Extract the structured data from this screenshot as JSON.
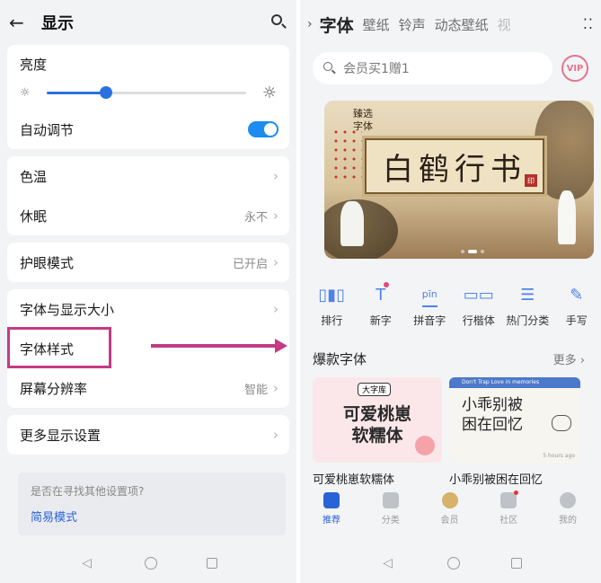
{
  "left": {
    "header": {
      "back_icon": "arrow-left-icon",
      "title": "显示",
      "search_icon": "search-icon"
    },
    "brightness": {
      "label": "亮度",
      "level": 0.3
    },
    "auto_adjust": {
      "label": "自动调节",
      "enabled": true
    },
    "rows_group2": [
      {
        "label": "色温",
        "value": ""
      },
      {
        "label": "休眠",
        "value": "永不"
      }
    ],
    "eye_comfort": {
      "label": "护眼模式",
      "value": "已开启"
    },
    "rows_group4": [
      {
        "label": "字体与显示大小",
        "value": ""
      },
      {
        "label": "字体样式",
        "value": ""
      },
      {
        "label": "屏幕分辨率",
        "value": "智能"
      }
    ],
    "more": {
      "label": "更多显示设置"
    },
    "suggest": {
      "question": "是否在寻找其他设置项?",
      "link": "简易模式"
    },
    "highlight_color": "#c53a84"
  },
  "right": {
    "tabs": [
      "字体",
      "壁纸",
      "铃声",
      "动态壁纸",
      "视"
    ],
    "search": {
      "placeholder": "会员买1赠1"
    },
    "vip_badge": "VIP",
    "banner": {
      "corner_text": "臻选\n字体",
      "big_text": "白鹤行书",
      "seal": "印"
    },
    "categories": [
      {
        "label": "排行",
        "icon": "bar-chart-icon"
      },
      {
        "label": "新字",
        "icon": "new-font-icon"
      },
      {
        "label": "拼音字",
        "icon": "pinyin-icon"
      },
      {
        "label": "行楷体",
        "icon": "book-icon"
      },
      {
        "label": "热门分类",
        "icon": "list-icon"
      },
      {
        "label": "手写",
        "icon": "pen-icon"
      }
    ],
    "section": {
      "title": "爆款字体",
      "more": "更多"
    },
    "cards": [
      {
        "name": "可爱桃崽软糯体",
        "tag": "大字库",
        "preview": "可爱桃崽\n软糯体"
      },
      {
        "name": "小乖别被困在回忆",
        "chat_header": "Don't Trap Love in memories",
        "preview": "小乖别被\n困在回忆",
        "time": "5 hours ago"
      }
    ],
    "bottom_nav": [
      {
        "label": "推荐",
        "active": true
      },
      {
        "label": "分类"
      },
      {
        "label": "会员"
      },
      {
        "label": "社区"
      },
      {
        "label": "我的"
      }
    ],
    "accent": "#2a63d6"
  }
}
